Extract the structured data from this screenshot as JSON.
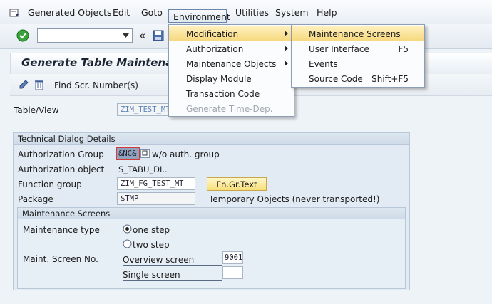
{
  "menubar": {
    "items": [
      "Generated Objects",
      "Edit",
      "Goto",
      "Environment",
      "Utilities",
      "System",
      "Help"
    ]
  },
  "title": "Generate Table Maintena",
  "toolbar": {
    "find_label": "Find Scr. Number(s)"
  },
  "form": {
    "table_view_label": "Table/View",
    "table_view_value": "ZIM_TEST_MT"
  },
  "tech": {
    "title": "Technical Dialog Details",
    "auth_group_label": "Authorization Group",
    "auth_group_value": "&NC&",
    "auth_group_desc": "w/o auth. group",
    "auth_object_label": "Authorization object",
    "auth_object_value": "S_TABU_DI..",
    "function_group_label": "Function group",
    "function_group_value": "ZIM_FG_TEST_MT",
    "fngr_button": "Fn.Gr.Text",
    "package_label": "Package",
    "package_value": "$TMP",
    "package_desc": "Temporary Objects (never transported!)"
  },
  "maint": {
    "title": "Maintenance Screens",
    "type_label": "Maintenance type",
    "one_step": "one step",
    "two_step": "two step",
    "screen_no_label": "Maint. Screen No.",
    "overview_label": "Overview screen",
    "overview_value": "9001",
    "single_label": "Single screen",
    "single_value": ""
  },
  "env_menu": {
    "items": [
      {
        "label": "Modification",
        "submenu": true,
        "highlighted": true
      },
      {
        "label": "Authorization",
        "submenu": true
      },
      {
        "label": "Maintenance Objects",
        "submenu": true
      },
      {
        "label": "Display Module"
      },
      {
        "label": "Transaction Code"
      },
      {
        "label": "Generate Time-Dep.",
        "disabled": true
      }
    ]
  },
  "mod_menu": {
    "items": [
      {
        "label": "Maintenance Screens",
        "shortcut": "",
        "highlighted": true
      },
      {
        "label": "User Interface",
        "shortcut": "F5"
      },
      {
        "label": "Events",
        "shortcut": ""
      },
      {
        "label": "Source Code",
        "shortcut": "Shift+F5"
      }
    ]
  },
  "colors": {
    "highlight": "#f6d77c",
    "accent_button": "#f7df7a",
    "field_border": "#a9b6c5"
  }
}
